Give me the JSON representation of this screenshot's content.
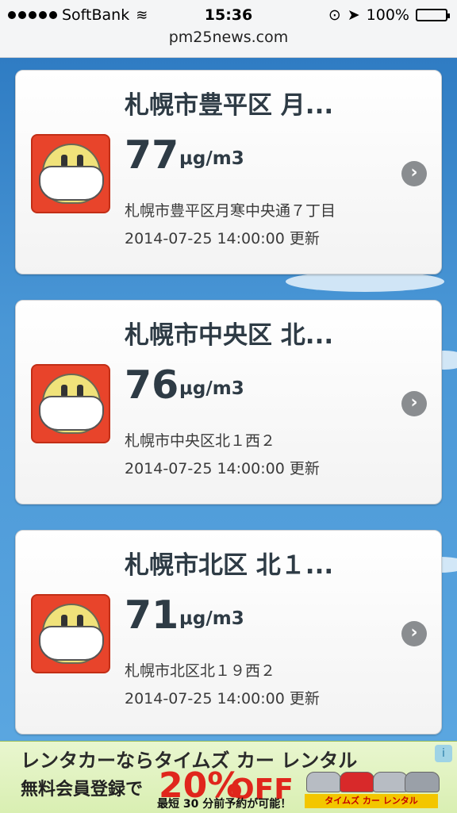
{
  "status_bar": {
    "carrier": "SoftBank",
    "time": "15:36",
    "battery": "100%",
    "battery_level": 1.0,
    "url": "pm25news.com"
  },
  "cards": [
    {
      "title": "札幌市豊平区 月...",
      "value": "77",
      "unit": "μg/m3",
      "address": "札幌市豊平区月寒中央通７丁目",
      "updated": "2014-07-25 14:00:00 更新"
    },
    {
      "title": "札幌市中央区 北...",
      "value": "76",
      "unit": "μg/m3",
      "address": "札幌市中央区北１西２",
      "updated": "2014-07-25 14:00:00 更新"
    },
    {
      "title": "札幌市北区 北１...",
      "value": "71",
      "unit": "μg/m3",
      "address": "札幌市北区北１９西２",
      "updated": "2014-07-25 14:00:00 更新"
    }
  ],
  "ad": {
    "line1": "レンタカーならタイムズ カー レンタル",
    "line2": "無料会員登録で",
    "percent": "20%",
    "off": "OFF",
    "line3": "最短 30 分前予約が可能！",
    "brand": "タイムズ カー レンタル",
    "info_icon": "i"
  },
  "colors": {
    "sky": "#3a86c9",
    "face_bg": "#e8442b",
    "offer": "#e0261c"
  }
}
